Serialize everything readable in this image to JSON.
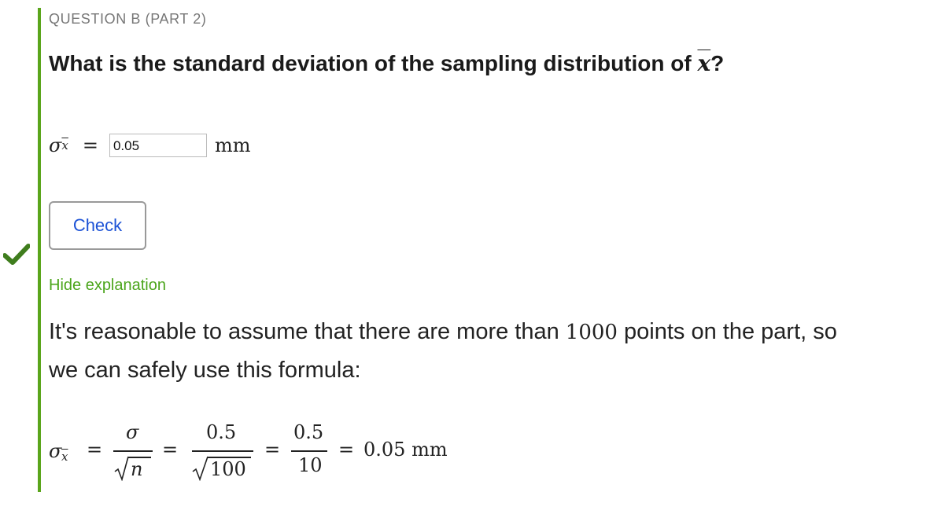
{
  "question": {
    "label": "QUESTION B (PART 2)",
    "title_text": "What is the standard deviation of the sampling distribution of ",
    "title_symbol": "x",
    "title_end": "?"
  },
  "answer": {
    "symbol": "σ",
    "subscript": "x",
    "equals": "=",
    "input_value": "0.05",
    "unit": "mm"
  },
  "check_button": {
    "label": "Check"
  },
  "status": {
    "correct": true,
    "icon": "checkmark-icon",
    "color": "#3f7d1d"
  },
  "explanation": {
    "toggle_label": "Hide explanation",
    "line1_before": "It's reasonable to assume that there are more than ",
    "line1_number": "1000",
    "line1_after": " points on the part, so",
    "line2": "we can safely use this formula:",
    "formula": {
      "lhs_symbol": "σ",
      "lhs_subscript": "x",
      "equals": "=",
      "frac1_num": "σ",
      "frac1_den": "n",
      "frac2_num": "0.5",
      "frac2_den": "100",
      "frac3_num": "0.5",
      "frac3_den": "10",
      "result": "0.05 mm"
    }
  },
  "colors": {
    "accent_bar": "#5aa51b",
    "link": "#4ba51b",
    "button_text": "#1c52d6"
  }
}
